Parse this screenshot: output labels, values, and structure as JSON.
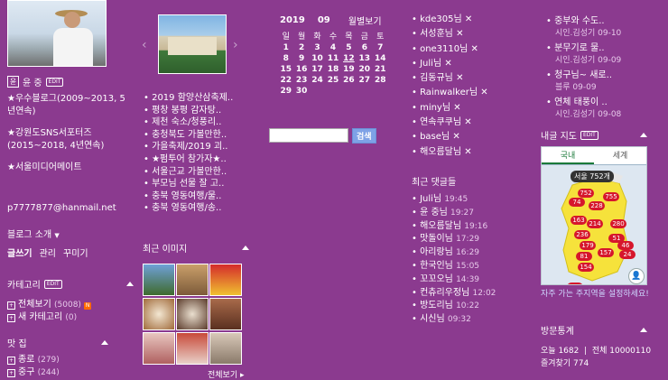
{
  "profile": {
    "name": "윤 중",
    "edit_badge": "EDIT",
    "awards": [
      "★우수블로그(2009~2013, 5년연속)",
      "★강원도SNS서포터즈(2015~2018, 4년연속)",
      "★서울미디어메이트"
    ],
    "email": "p7777877@hanmail.net",
    "blog_intro": "블로그 소개",
    "actions": [
      "글쓰기",
      "관리",
      "꾸미기"
    ]
  },
  "category": {
    "title": "카테고리",
    "edit_badge": "EDIT",
    "items": [
      {
        "label": "전체보기",
        "count": "(5008)",
        "new": "N"
      },
      {
        "label": "새 카테고리",
        "count": "(0)"
      }
    ]
  },
  "tastes": {
    "title": "맛 집",
    "items": [
      {
        "label": "종로",
        "count": "(279)"
      },
      {
        "label": "중구",
        "count": "(244)"
      }
    ]
  },
  "recent_posts": [
    "2019 함양산삼축제..",
    "평창 봉평 감자탕..",
    "제천 숙소/청풍리..",
    "충청북도 가볼만한..",
    "가을축제/2019 괴..",
    "★펌투어 참가자★..",
    "서울근교 가볼만한..",
    "부모님 선물 잘 고..",
    "충북 영동여행/물..",
    "충북 영동여행/송.."
  ],
  "recent_images": {
    "title": "최근 이미지",
    "more": "전체보기"
  },
  "calendar": {
    "year": "2019",
    "month": "09",
    "monthly_view": "월별보기",
    "weekdays": [
      "일",
      "월",
      "화",
      "수",
      "목",
      "금",
      "토"
    ],
    "weeks": [
      [
        "1",
        "2",
        "3",
        "4",
        "5",
        "6",
        "7"
      ],
      [
        "8",
        "9",
        "10",
        "11",
        "12",
        "13",
        "14"
      ],
      [
        "15",
        "16",
        "17",
        "18",
        "19",
        "20",
        "21"
      ],
      [
        "22",
        "23",
        "24",
        "25",
        "26",
        "27",
        "28"
      ],
      [
        "29",
        "30",
        "",
        "",
        "",
        "",
        ""
      ]
    ]
  },
  "search": {
    "button": "검색",
    "value": ""
  },
  "neighbors": [
    "kde305님",
    "서성훈님",
    "one3110님",
    "Juli님",
    "김동규님",
    "Rainwalker님",
    "miny님",
    "연속쿠쿠님",
    "base님",
    "해오름달님"
  ],
  "recent_comments": {
    "title": "최근 댓글들",
    "items": [
      {
        "name": "Juli님",
        "time": "19:45"
      },
      {
        "name": "윤 중님",
        "time": "19:27"
      },
      {
        "name": "해오름달님",
        "time": "19:16"
      },
      {
        "name": "맛돌이님",
        "time": "17:29"
      },
      {
        "name": "아리랑님",
        "time": "16:29"
      },
      {
        "name": "한국인님",
        "time": "15:05"
      },
      {
        "name": "꼬꼬오님",
        "time": "14:39"
      },
      {
        "name": "컨츄리우정님",
        "time": "12:02"
      },
      {
        "name": "방도리님",
        "time": "10:22"
      },
      {
        "name": "시신님",
        "time": "09:32"
      }
    ]
  },
  "guestbook": [
    {
      "title": "중부와 수도..",
      "sub": "시인.김성기 09-10"
    },
    {
      "title": "분무기로 물..",
      "sub": "시인.김성기 09-09"
    },
    {
      "title": "청구님~ 새로..",
      "sub": "블루 09-09"
    },
    {
      "title": "연체 태풍이 ..",
      "sub": "시인.김성기 09-08"
    }
  ],
  "map": {
    "title": "내글 지도",
    "edit_badge": "EDIT",
    "tabs": [
      "국내",
      "세계"
    ],
    "seoul_label": "서울 752개",
    "pins": [
      "752",
      "74",
      "228",
      "755",
      "163",
      "214",
      "280",
      "236",
      "51",
      "179",
      "46",
      "24",
      "157",
      "81",
      "154",
      "301"
    ],
    "footer": "자주 가는 주지역을 설정하세요!"
  },
  "visitors": {
    "title": "방문통계",
    "today_label": "오늘",
    "today": "1682",
    "total_label": "전체",
    "total": "10000110",
    "fav_label": "즐겨찾기",
    "fav": "774"
  }
}
